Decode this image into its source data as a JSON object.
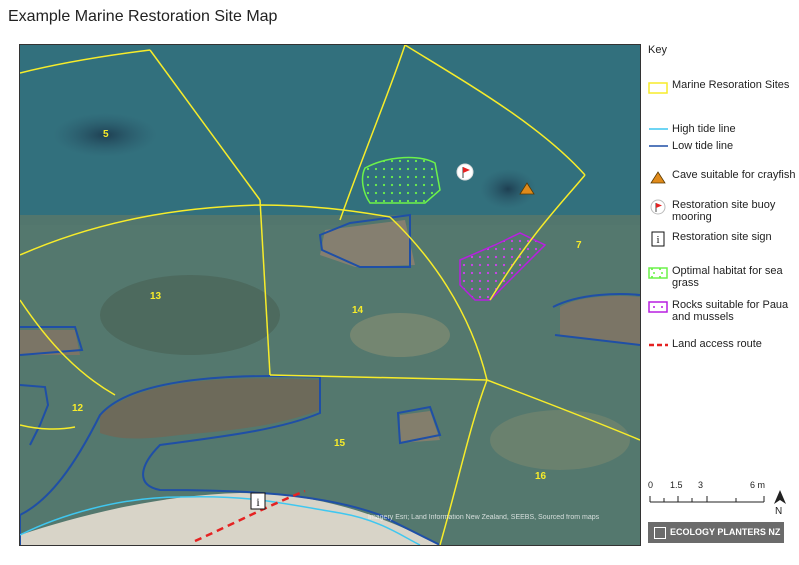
{
  "title": "Example Marine Restoration Site Map",
  "map": {
    "site_numbers": [
      "5",
      "13",
      "14",
      "7",
      "12",
      "15",
      "16"
    ],
    "attribution": "Imagery Esri; Land Information New Zealand, SEEBS, Sourced from maps",
    "colors": {
      "site_boundary": "#f7ec2a",
      "high_tide": "#3fc7f0",
      "low_tide": "#1f4fa6",
      "seagrass": "#6cf24a",
      "rocks_paua": "#b81fe0",
      "access_route": "#e52222",
      "cave": "#e08a1a"
    }
  },
  "key": {
    "title": "Key",
    "items": [
      {
        "label": "Marine Resoration Sites",
        "icon": "yellow-outline-box"
      },
      {
        "label": "High tide line",
        "icon": "cyan-line"
      },
      {
        "label": "Low tide line",
        "icon": "blue-line"
      },
      {
        "label": "Cave suitable for crayfish",
        "icon": "orange-triangle"
      },
      {
        "label": "Restoration site buoy mooring",
        "icon": "red-flag-buoy"
      },
      {
        "label": "Restoration site sign",
        "icon": "info-sign"
      },
      {
        "label": "Optimal habitat for sea grass",
        "icon": "green-dotted-box"
      },
      {
        "label": "Rocks suitable for Paua and mussels",
        "icon": "purple-dotted-box"
      },
      {
        "label": "Land access route",
        "icon": "red-dashed-line"
      }
    ]
  },
  "scale": {
    "ticks": [
      "0",
      "1.5",
      "3",
      "6 m"
    ],
    "north": "N"
  },
  "logo": {
    "text": "ECOLOGY PLANTERS NZ"
  }
}
